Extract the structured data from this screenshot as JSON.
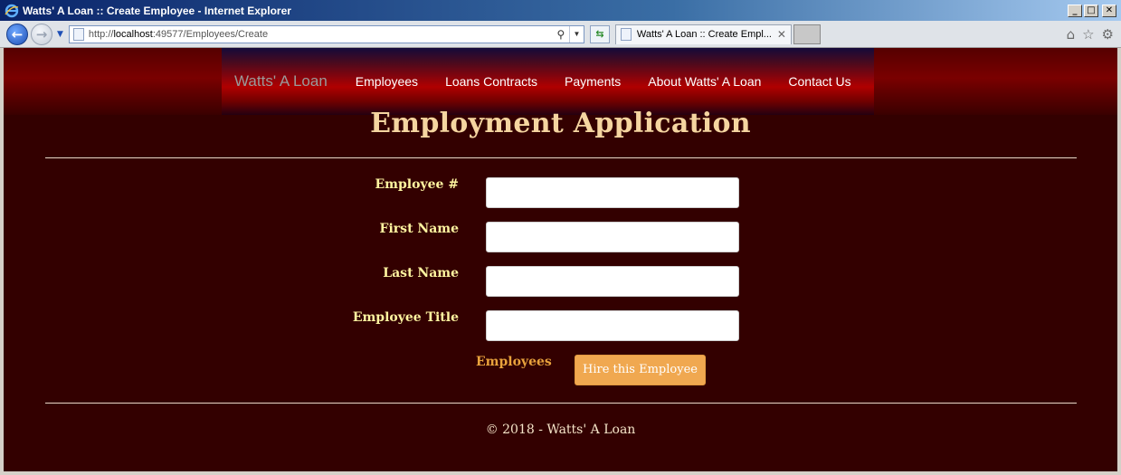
{
  "window": {
    "title": "Watts' A Loan :: Create Employee - Internet Explorer",
    "minimize": "_",
    "maximize": "□",
    "close": "✕"
  },
  "browser": {
    "address_prefix": "http://",
    "address_host": "localhost",
    "address_rest": ":49577/Employees/Create",
    "tab_label": "Watts' A Loan :: Create Empl...",
    "tab_close": "✕",
    "home_icon": "⌂",
    "favorites_icon": "☆",
    "tools_icon": "⚙"
  },
  "nav": {
    "brand": "Watts' A Loan",
    "links": [
      "Employees",
      "Loans Contracts",
      "Payments",
      "About Watts' A Loan",
      "Contact Us"
    ]
  },
  "page": {
    "title": "Employment Application"
  },
  "form": {
    "fields": [
      {
        "label": "Employee #",
        "value": ""
      },
      {
        "label": "First Name",
        "value": ""
      },
      {
        "label": "Last Name",
        "value": ""
      },
      {
        "label": "Employee Title",
        "value": ""
      }
    ],
    "back_link": "Employees",
    "submit": "Hire this Employee"
  },
  "footer": {
    "text": "© 2018 - Watts' A Loan"
  },
  "colors": {
    "page_bg": "#330000",
    "title": "#f5d5a0",
    "label": "#fff5a0",
    "accent": "#f0a850"
  }
}
